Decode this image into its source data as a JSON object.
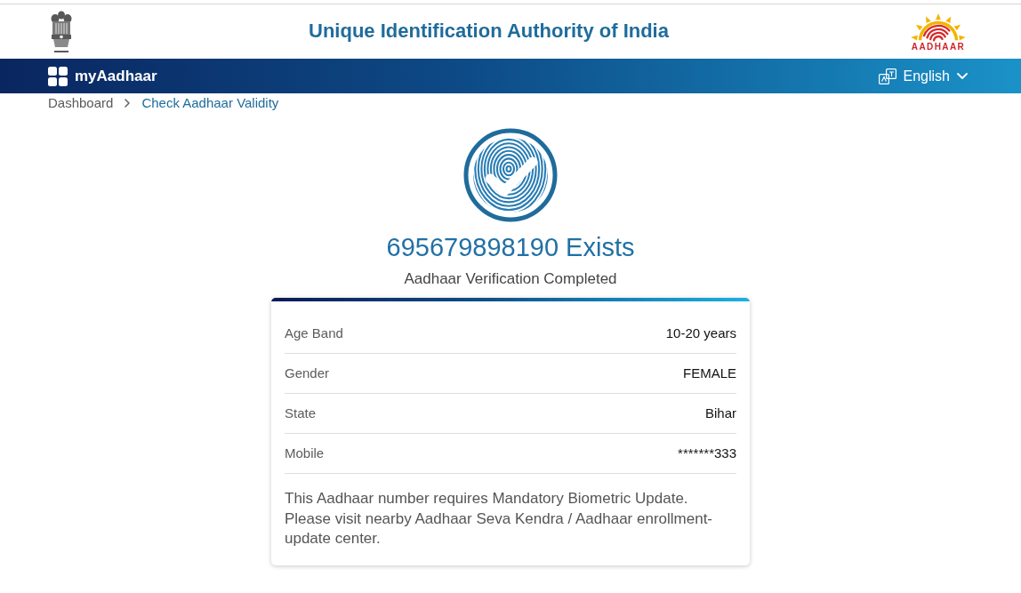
{
  "header": {
    "title": "Unique Identification Authority of India",
    "logo_text": "AADHAAR"
  },
  "navbar": {
    "brand": "myAadhaar",
    "language": "English"
  },
  "breadcrumb": [
    {
      "label": "Dashboard",
      "current": false
    },
    {
      "label": "Check Aadhaar Validity",
      "current": true
    }
  ],
  "result": {
    "heading": "695679898190 Exists",
    "subheading": "Aadhaar Verification Completed"
  },
  "details": [
    {
      "label": "Age Band",
      "value": "10-20 years"
    },
    {
      "label": "Gender",
      "value": "FEMALE"
    },
    {
      "label": "State",
      "value": "Bihar"
    },
    {
      "label": "Mobile",
      "value": "*******333"
    }
  ],
  "notice": "This Aadhaar number requires Mandatory Biometric Update. Please visit nearby Aadhaar Seva Kendra / Aadhaar enrollment-update center."
}
